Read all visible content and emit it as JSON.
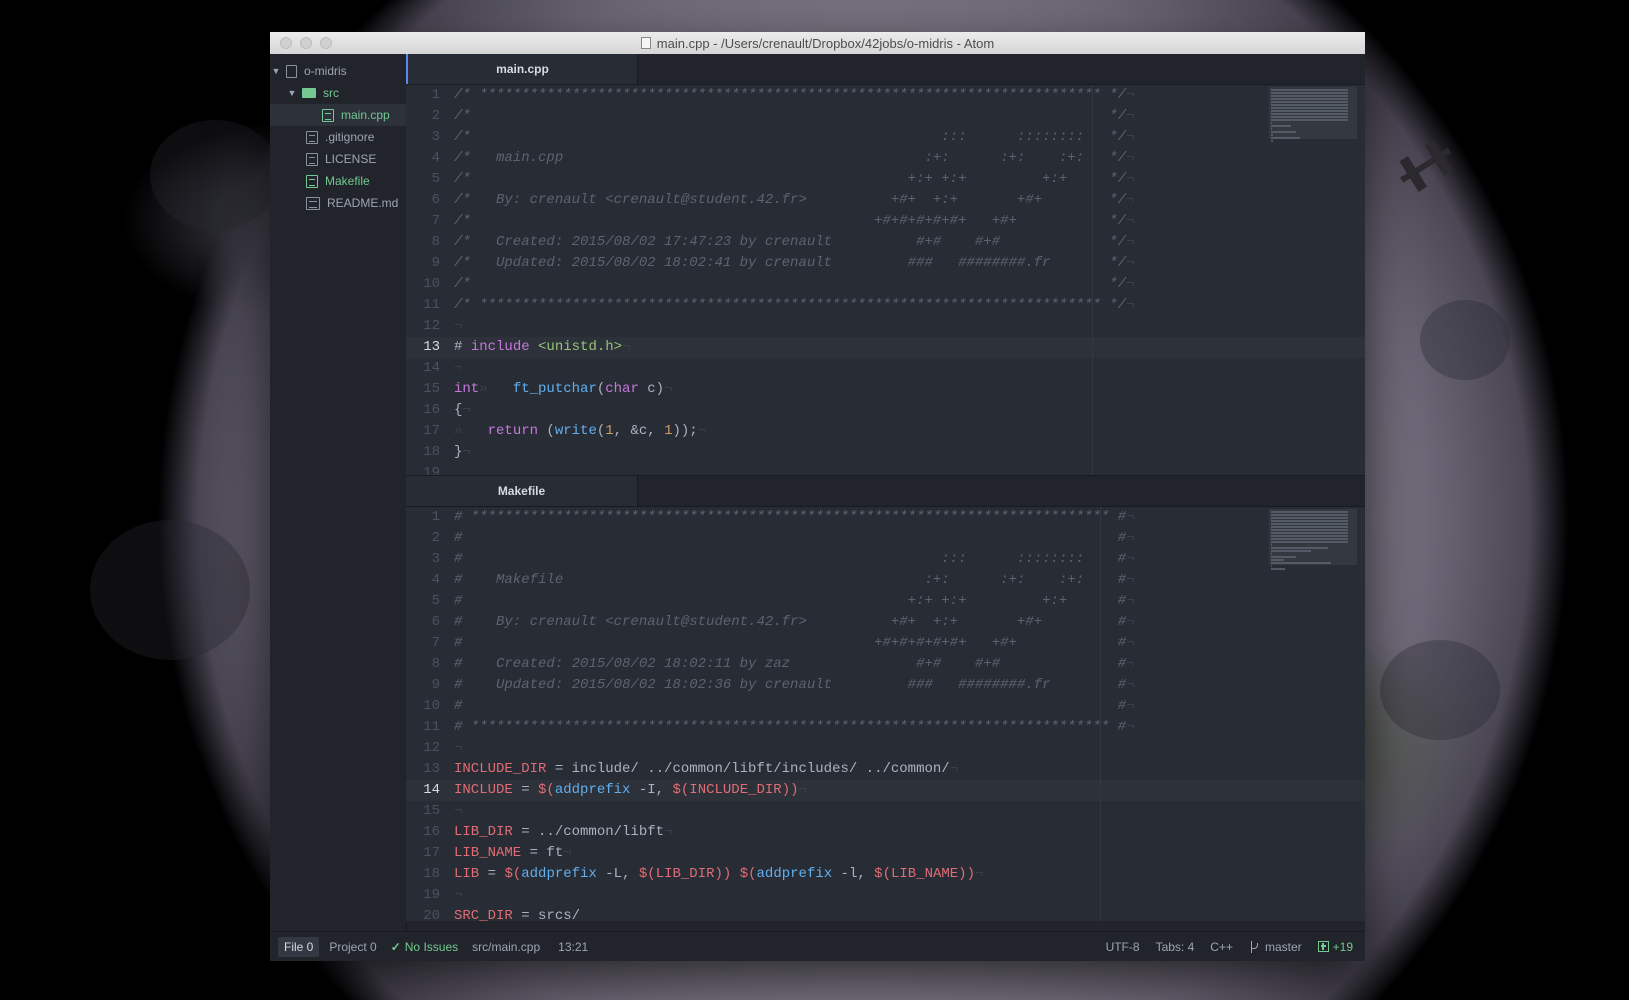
{
  "window": {
    "title": "main.cpp - /Users/crenault/Dropbox/42jobs/o-midris - Atom"
  },
  "tree": {
    "root": "o-midris",
    "src_folder": "src",
    "items": [
      {
        "label": "main.cpp"
      },
      {
        "label": ".gitignore"
      },
      {
        "label": "LICENSE"
      },
      {
        "label": "Makefile"
      },
      {
        "label": "README.md"
      }
    ]
  },
  "top_pane": {
    "tab": "main.cpp",
    "cursor_line": 13,
    "lines": [
      [
        [
          "c-comment",
          "/* ************************************************************************** */"
        ],
        [
          "c-inv",
          "¬"
        ]
      ],
      [
        [
          "c-comment",
          "/*                                                                            */"
        ],
        [
          "c-inv",
          "¬"
        ]
      ],
      [
        [
          "c-comment",
          "/*                                                        :::      ::::::::   */"
        ],
        [
          "c-inv",
          "¬"
        ]
      ],
      [
        [
          "c-comment",
          "/*   main.cpp                                           :+:      :+:    :+:   */"
        ],
        [
          "c-inv",
          "¬"
        ]
      ],
      [
        [
          "c-comment",
          "/*                                                    +:+ +:+         +:+     */"
        ],
        [
          "c-inv",
          "¬"
        ]
      ],
      [
        [
          "c-comment",
          "/*   By: crenault <crenault@student.42.fr>          +#+  +:+       +#+        */"
        ],
        [
          "c-inv",
          "¬"
        ]
      ],
      [
        [
          "c-comment",
          "/*                                                +#+#+#+#+#+   +#+           */"
        ],
        [
          "c-inv",
          "¬"
        ]
      ],
      [
        [
          "c-comment",
          "/*   Created: 2015/08/02 17:47:23 by crenault          #+#    #+#             */"
        ],
        [
          "c-inv",
          "¬"
        ]
      ],
      [
        [
          "c-comment",
          "/*   Updated: 2015/08/02 18:02:41 by crenault         ###   ########.fr       */"
        ],
        [
          "c-inv",
          "¬"
        ]
      ],
      [
        [
          "c-comment",
          "/*                                                                            */"
        ],
        [
          "c-inv",
          "¬"
        ]
      ],
      [
        [
          "c-comment",
          "/* ************************************************************************** */"
        ],
        [
          "c-inv",
          "¬"
        ]
      ],
      [
        [
          "c-inv",
          "¬"
        ]
      ],
      [
        [
          "",
          "# "
        ],
        [
          "c-kw",
          "include"
        ],
        [
          "",
          " "
        ],
        [
          "c-str",
          "<unistd.h>"
        ],
        [
          "c-inv",
          "¬"
        ]
      ],
      [
        [
          "c-inv",
          "¬"
        ]
      ],
      [
        [
          "c-kw",
          "int"
        ],
        [
          "c-inv",
          "»   "
        ],
        [
          "",
          ""
        ],
        [
          "c-fn",
          "ft_putchar"
        ],
        [
          "",
          "("
        ],
        [
          "c-kw",
          "char"
        ],
        [
          "",
          " c)"
        ],
        [
          "c-inv",
          "¬"
        ]
      ],
      [
        [
          "",
          "{"
        ],
        [
          "c-inv",
          "¬"
        ]
      ],
      [
        [
          "c-inv",
          "»   "
        ],
        [
          "c-kw",
          "return"
        ],
        [
          "",
          " ("
        ],
        [
          "c-fn",
          "write"
        ],
        [
          "",
          "("
        ],
        [
          "c-num",
          "1"
        ],
        [
          "",
          ", &c, "
        ],
        [
          "c-num",
          "1"
        ],
        [
          "",
          "));"
        ],
        [
          "c-inv",
          "¬"
        ]
      ],
      [
        [
          "",
          "}"
        ],
        [
          "c-inv",
          "¬"
        ]
      ],
      [
        [
          "",
          ""
        ]
      ]
    ]
  },
  "bottom_pane": {
    "tab": "Makefile",
    "cursor_line": 14,
    "lines": [
      [
        [
          "c-comment",
          "# **************************************************************************** #"
        ],
        [
          "c-inv",
          "¬"
        ]
      ],
      [
        [
          "c-comment",
          "#                                                                              #"
        ],
        [
          "c-inv",
          "¬"
        ]
      ],
      [
        [
          "c-comment",
          "#                                                         :::      ::::::::    #"
        ],
        [
          "c-inv",
          "¬"
        ]
      ],
      [
        [
          "c-comment",
          "#    Makefile                                           :+:      :+:    :+:    #"
        ],
        [
          "c-inv",
          "¬"
        ]
      ],
      [
        [
          "c-comment",
          "#                                                     +:+ +:+         +:+      #"
        ],
        [
          "c-inv",
          "¬"
        ]
      ],
      [
        [
          "c-comment",
          "#    By: crenault <crenault@student.42.fr>          +#+  +:+       +#+         #"
        ],
        [
          "c-inv",
          "¬"
        ]
      ],
      [
        [
          "c-comment",
          "#                                                 +#+#+#+#+#+   +#+            #"
        ],
        [
          "c-inv",
          "¬"
        ]
      ],
      [
        [
          "c-comment",
          "#    Created: 2015/08/02 18:02:11 by zaz               #+#    #+#              #"
        ],
        [
          "c-inv",
          "¬"
        ]
      ],
      [
        [
          "c-comment",
          "#    Updated: 2015/08/02 18:02:36 by crenault         ###   ########.fr        #"
        ],
        [
          "c-inv",
          "¬"
        ]
      ],
      [
        [
          "c-comment",
          "#                                                                              #"
        ],
        [
          "c-inv",
          "¬"
        ]
      ],
      [
        [
          "c-comment",
          "# **************************************************************************** #"
        ],
        [
          "c-inv",
          "¬"
        ]
      ],
      [
        [
          "c-inv",
          "¬"
        ]
      ],
      [
        [
          "c-var",
          "INCLUDE_DIR"
        ],
        [
          "",
          " = include/ ../common/libft/includes/ ../common/"
        ],
        [
          "c-inv",
          "¬"
        ]
      ],
      [
        [
          "c-var",
          "INCLUDE"
        ],
        [
          "",
          " = "
        ],
        [
          "c-var",
          "$("
        ],
        [
          "c-fn",
          "addprefix"
        ],
        [
          "",
          " -I, "
        ],
        [
          "c-var",
          "$(INCLUDE_DIR))"
        ],
        [
          "c-inv",
          "¬"
        ]
      ],
      [
        [
          "c-inv",
          "¬"
        ]
      ],
      [
        [
          "c-var",
          "LIB_DIR"
        ],
        [
          "",
          " = ../common/libft"
        ],
        [
          "c-inv",
          "¬"
        ]
      ],
      [
        [
          "c-var",
          "LIB_NAME"
        ],
        [
          "",
          " = ft"
        ],
        [
          "c-inv",
          "¬"
        ]
      ],
      [
        [
          "c-var",
          "LIB"
        ],
        [
          "",
          " = "
        ],
        [
          "c-var",
          "$("
        ],
        [
          "c-fn",
          "addprefix"
        ],
        [
          "",
          " -L, "
        ],
        [
          "c-var",
          "$(LIB_DIR))"
        ],
        [
          "",
          " "
        ],
        [
          "c-var",
          "$("
        ],
        [
          "c-fn",
          "addprefix"
        ],
        [
          "",
          " -l, "
        ],
        [
          "c-var",
          "$(LIB_NAME))"
        ],
        [
          "c-inv",
          "¬"
        ]
      ],
      [
        [
          "c-inv",
          "¬"
        ]
      ],
      [
        [
          "c-var",
          "SRC_DIR"
        ],
        [
          "",
          " = srcs/"
        ]
      ]
    ]
  },
  "statusbar": {
    "file_btn": "File 0",
    "project_btn": "Project 0",
    "issues": "No Issues",
    "path": "src/main.cpp",
    "position": "13:21",
    "encoding": "UTF-8",
    "tabs": "Tabs: 4",
    "grammar": "C++",
    "branch": "master",
    "diff": "+19"
  },
  "colors": {
    "accent": "#568af2",
    "git_added": "#73c990",
    "editor_bg": "#282c34",
    "panel_bg": "#21252b"
  }
}
